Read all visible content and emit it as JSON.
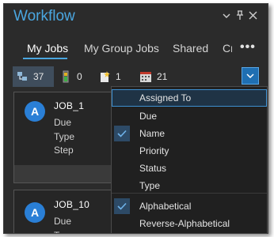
{
  "window": {
    "title": "Workflow",
    "dropdown_glyph": "▾",
    "pin_glyph": "ᵖ",
    "close_glyph": "✕"
  },
  "tabs": [
    {
      "label": "My Jobs",
      "active": true
    },
    {
      "label": "My Group Jobs",
      "active": false
    },
    {
      "label": "Shared",
      "active": false
    },
    {
      "label": "Cr",
      "active": false
    }
  ],
  "more_glyph": "•••",
  "filters": [
    {
      "icon": "jobs-filter-icon",
      "count": "37",
      "selected": true
    },
    {
      "icon": "battery-filter-icon",
      "count": "0",
      "selected": false
    },
    {
      "icon": "new-job-filter-icon",
      "count": "1",
      "selected": false
    },
    {
      "icon": "calendar-filter-icon",
      "count": "21",
      "selected": false
    }
  ],
  "cards": [
    {
      "avatar": "A",
      "title": "JOB_1",
      "fields": [
        "Due",
        "Type",
        "Step"
      ]
    },
    {
      "avatar": "A",
      "title": "JOB_10",
      "fields": [
        "Due",
        "T"
      ]
    }
  ],
  "sort_menu": {
    "items": [
      {
        "label": "Assigned To",
        "checked": false,
        "hover": true
      },
      {
        "label": "Due",
        "checked": false
      },
      {
        "label": "Name",
        "checked": true
      },
      {
        "label": "Priority",
        "checked": false
      },
      {
        "label": "Status",
        "checked": false
      },
      {
        "label": "Type",
        "checked": false
      },
      {
        "label": "Alphabetical",
        "checked": true
      },
      {
        "label": "Reverse-Alphabetical",
        "checked": false
      }
    ]
  },
  "colors": {
    "accent": "#4aa6e0",
    "panel": "#2b2b2b",
    "menu": "#202020",
    "avatar": "#2a7fd6"
  }
}
